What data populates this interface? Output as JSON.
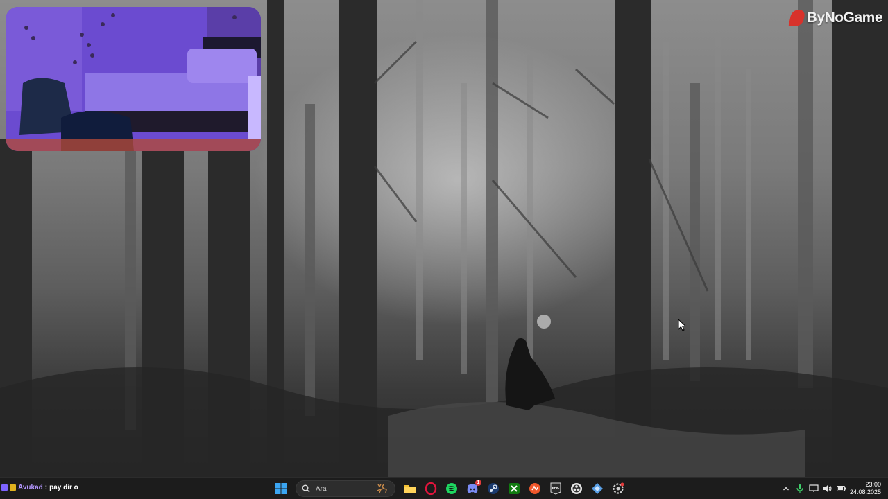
{
  "brand": {
    "name": "ByNoGame"
  },
  "chat": {
    "username": "Avukad",
    "separator": ":",
    "message": "pay dir o"
  },
  "taskbar": {
    "search_placeholder": "Ara",
    "apps": [
      {
        "name": "start-icon"
      },
      {
        "name": "file-explorer-icon"
      },
      {
        "name": "opera-gx-icon"
      },
      {
        "name": "spotify-icon"
      },
      {
        "name": "discord-icon",
        "badge": "1"
      },
      {
        "name": "steam-icon"
      },
      {
        "name": "xbox-icon"
      },
      {
        "name": "ea-icon"
      },
      {
        "name": "epic-games-icon"
      },
      {
        "name": "obs-icon"
      },
      {
        "name": "app-icon"
      },
      {
        "name": "settings-icon"
      }
    ],
    "discord_badge": "1",
    "epic_label": "EPIC"
  },
  "tray": {
    "icons": [
      "chevron-up-icon",
      "microphone-icon",
      "network-icon",
      "volume-icon",
      "battery-icon"
    ]
  },
  "clock": {
    "time": "23:00",
    "date": "24.08.2025"
  },
  "colors": {
    "taskbar_bg": "#1c1c1c",
    "brand_accent": "#d8322b",
    "chat_username": "#b497ff"
  }
}
